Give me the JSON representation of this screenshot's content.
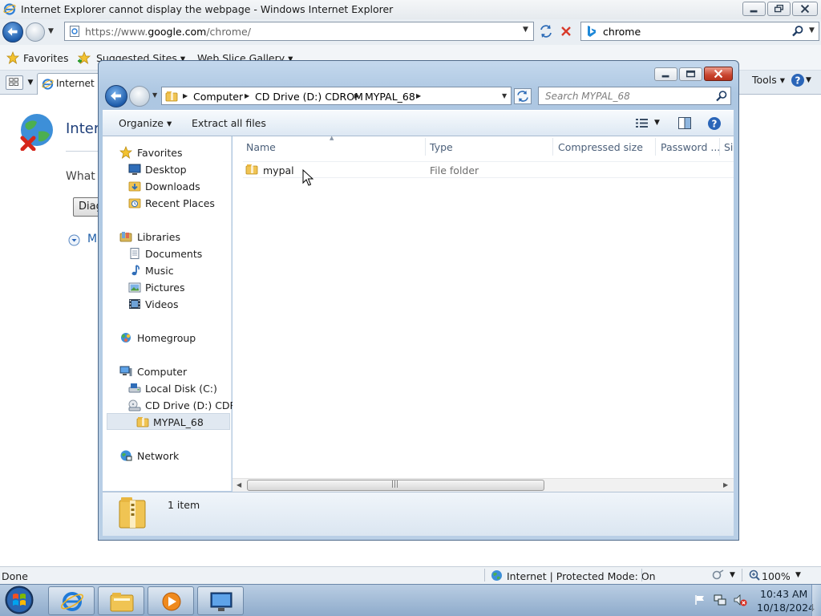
{
  "ie": {
    "title": "Internet Explorer cannot display the webpage - Windows Internet Explorer",
    "address_prefix": "https://www.",
    "address_host": "google.com",
    "address_path": "/chrome/",
    "search_value": "chrome",
    "favorites_label": "Favorites",
    "suggested_sites": "Suggested Sites ▾",
    "web_slice_gallery": "Web Slice Gallery ▾",
    "tab_label": "Internet Ex",
    "tools_label": "Tools ▾",
    "error_title": "Intern",
    "error_question": "What y",
    "diagnose_label": "Diag",
    "more_info": "M",
    "status_done": "Done",
    "status_zone": "Internet | Protected Mode: On",
    "zoom": "100%"
  },
  "explorer": {
    "breadcrumbs": [
      "Computer",
      "CD Drive (D:) CDROM",
      "MYPAL_68"
    ],
    "search_placeholder": "Search MYPAL_68",
    "commands": {
      "organize": "Organize ▾",
      "extract": "Extract all files"
    },
    "nav": {
      "favorites": "Favorites",
      "desktop": "Desktop",
      "downloads": "Downloads",
      "recent_places": "Recent Places",
      "libraries": "Libraries",
      "documents": "Documents",
      "music": "Music",
      "pictures": "Pictures",
      "videos": "Videos",
      "homegroup": "Homegroup",
      "computer": "Computer",
      "local_disk": "Local Disk (C:)",
      "cd_drive": "CD Drive (D:) CDROM",
      "mypal": "MYPAL_68",
      "network": "Network"
    },
    "columns": [
      "Name",
      "Type",
      "Compressed size",
      "Password ...",
      "Si"
    ],
    "files": [
      {
        "name": "mypal",
        "type": "File folder"
      }
    ],
    "item_count": "1 item"
  },
  "taskbar": {
    "time": "10:43 AM",
    "date": "10/18/2024"
  },
  "colors": {
    "accent": "#1c5aa8",
    "close_red": "#c9452f",
    "folder_yellow": "#f3c955"
  }
}
